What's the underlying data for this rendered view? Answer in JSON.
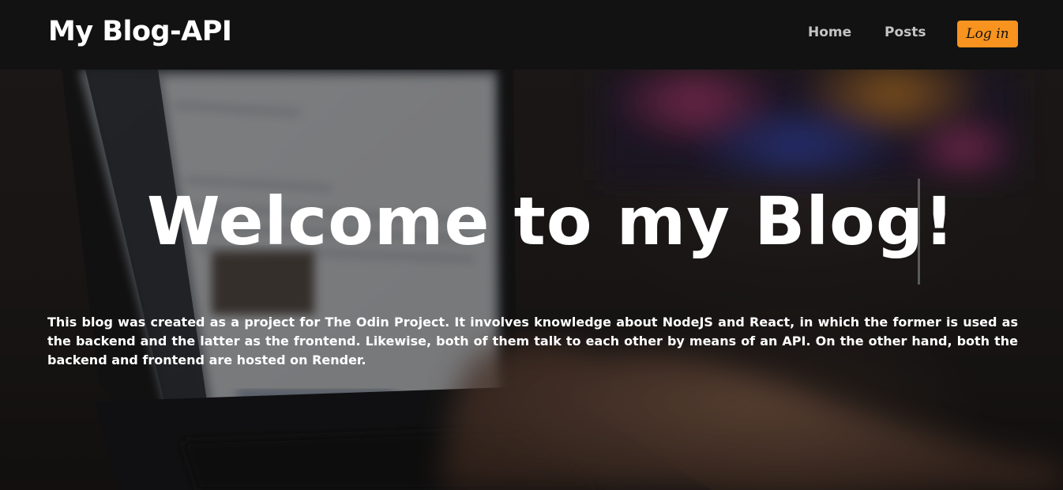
{
  "header": {
    "brand": "My Blog-API",
    "nav": {
      "home_label": "Home",
      "posts_label": "Posts"
    },
    "login_label": "Log in"
  },
  "hero": {
    "title": "Welcome to my Blog!",
    "description": "This blog was created as a project for The Odin Project. It involves knowledge about NodeJS and React, in which the former is used as the backend and the latter as the frontend. Likewise, both of them talk to each other by means of an API. On the other hand, both the backend and frontend are hosted on Render."
  },
  "colors": {
    "header_bg": "#121212",
    "login_button": "#f7931e",
    "nav_text": "#c4c4c4",
    "hero_text": "#ffffff"
  }
}
